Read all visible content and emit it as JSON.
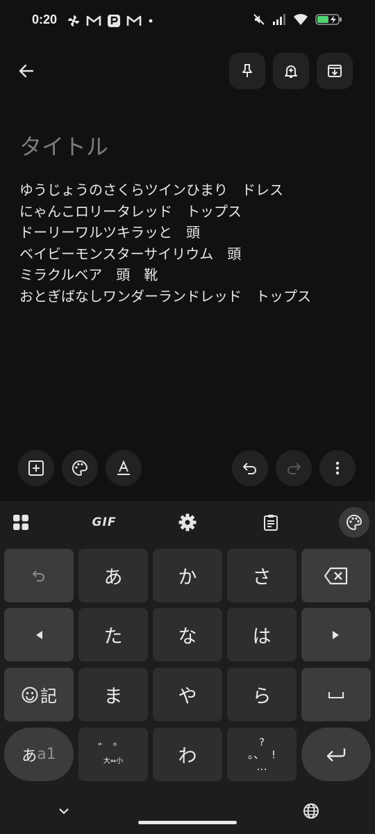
{
  "status_bar": {
    "time": "0:20",
    "notification_icons": [
      "pinwheel-icon",
      "gmail-icon",
      "p-app-icon",
      "gmail-icon",
      "dot-icon"
    ],
    "system_icons": [
      "mute-icon",
      "signal-icon",
      "wifi-icon",
      "battery-charging-icon"
    ]
  },
  "toolbar": {
    "back": "arrow-left-icon",
    "actions": [
      "pin-icon",
      "reminder-bell-icon",
      "archive-icon"
    ]
  },
  "note": {
    "title_placeholder": "タイトル",
    "lines": [
      "ゆうじょうのさくらツインひまり　ドレス",
      "にゃんこロリータレッド　トップス",
      "ドーリーワルツキラッと　頭",
      "ベイビーモンスターサイリウム　頭",
      "ミラクルベア　頭　靴",
      "おとぎばなしワンダーランドレッド　トップス"
    ]
  },
  "editor_toolbar": {
    "left": [
      "add-box-icon",
      "palette-icon",
      "text-format-icon"
    ],
    "right": [
      "undo-icon",
      "redo-icon",
      "more-vert-icon"
    ]
  },
  "keyboard": {
    "strip": {
      "gif": "GIF"
    },
    "keys": {
      "a": "あ",
      "ka": "か",
      "sa": "さ",
      "ta": "た",
      "na": "な",
      "ha": "は",
      "ma": "ま",
      "ya": "や",
      "ra": "ら",
      "wa": "わ",
      "kigou": "記",
      "mode_kana": "あ",
      "mode_alnum": "a1",
      "dakuten_top": "゛゜",
      "dakuten_bottom": "大⇔小",
      "punct_q": "?",
      "punct_main": "。、",
      "punct_ex": "!",
      "punct_dots": "…"
    }
  }
}
